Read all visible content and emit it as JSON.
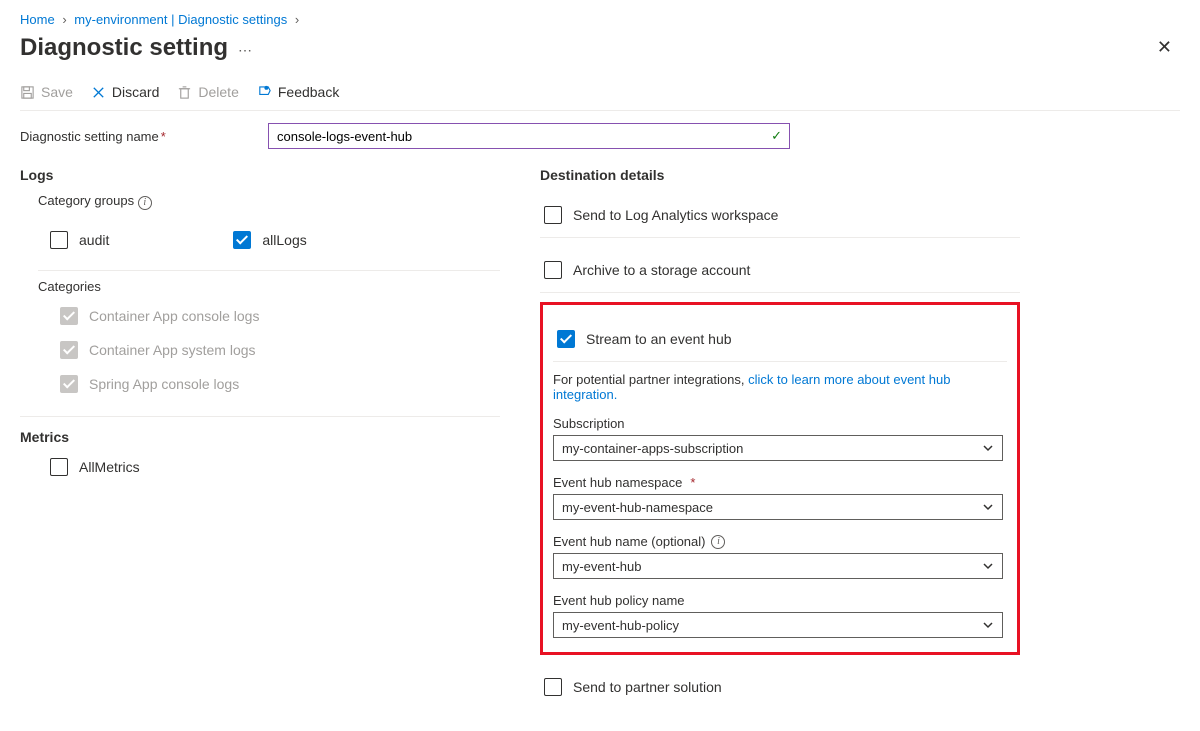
{
  "breadcrumb": {
    "home": "Home",
    "env": "my-environment | Diagnostic settings"
  },
  "page_title": "Diagnostic setting",
  "toolbar": {
    "save": "Save",
    "discard": "Discard",
    "delete": "Delete",
    "feedback": "Feedback"
  },
  "name": {
    "label": "Diagnostic setting name",
    "value": "console-logs-event-hub"
  },
  "logs": {
    "heading": "Logs",
    "cat_groups_label": "Category groups",
    "audit": "audit",
    "allLogs": "allLogs",
    "categories_label": "Categories",
    "cat1": "Container App console logs",
    "cat2": "Container App system logs",
    "cat3": "Spring App console logs"
  },
  "metrics": {
    "heading": "Metrics",
    "all": "AllMetrics"
  },
  "dest": {
    "heading": "Destination details",
    "log_analytics": "Send to Log Analytics workspace",
    "archive": "Archive to a storage account",
    "eventhub": "Stream to an event hub",
    "partner_intro": "For potential partner integrations, ",
    "partner_link": "click to learn more about event hub integration.",
    "sub_label": "Subscription",
    "sub_value": "my-container-apps-subscription",
    "ns_label": "Event hub namespace",
    "ns_value": "my-event-hub-namespace",
    "ehname_label": "Event hub name (optional)",
    "ehname_value": "my-event-hub",
    "policy_label": "Event hub policy name",
    "policy_value": "my-event-hub-policy",
    "partner_solution": "Send to partner solution"
  }
}
